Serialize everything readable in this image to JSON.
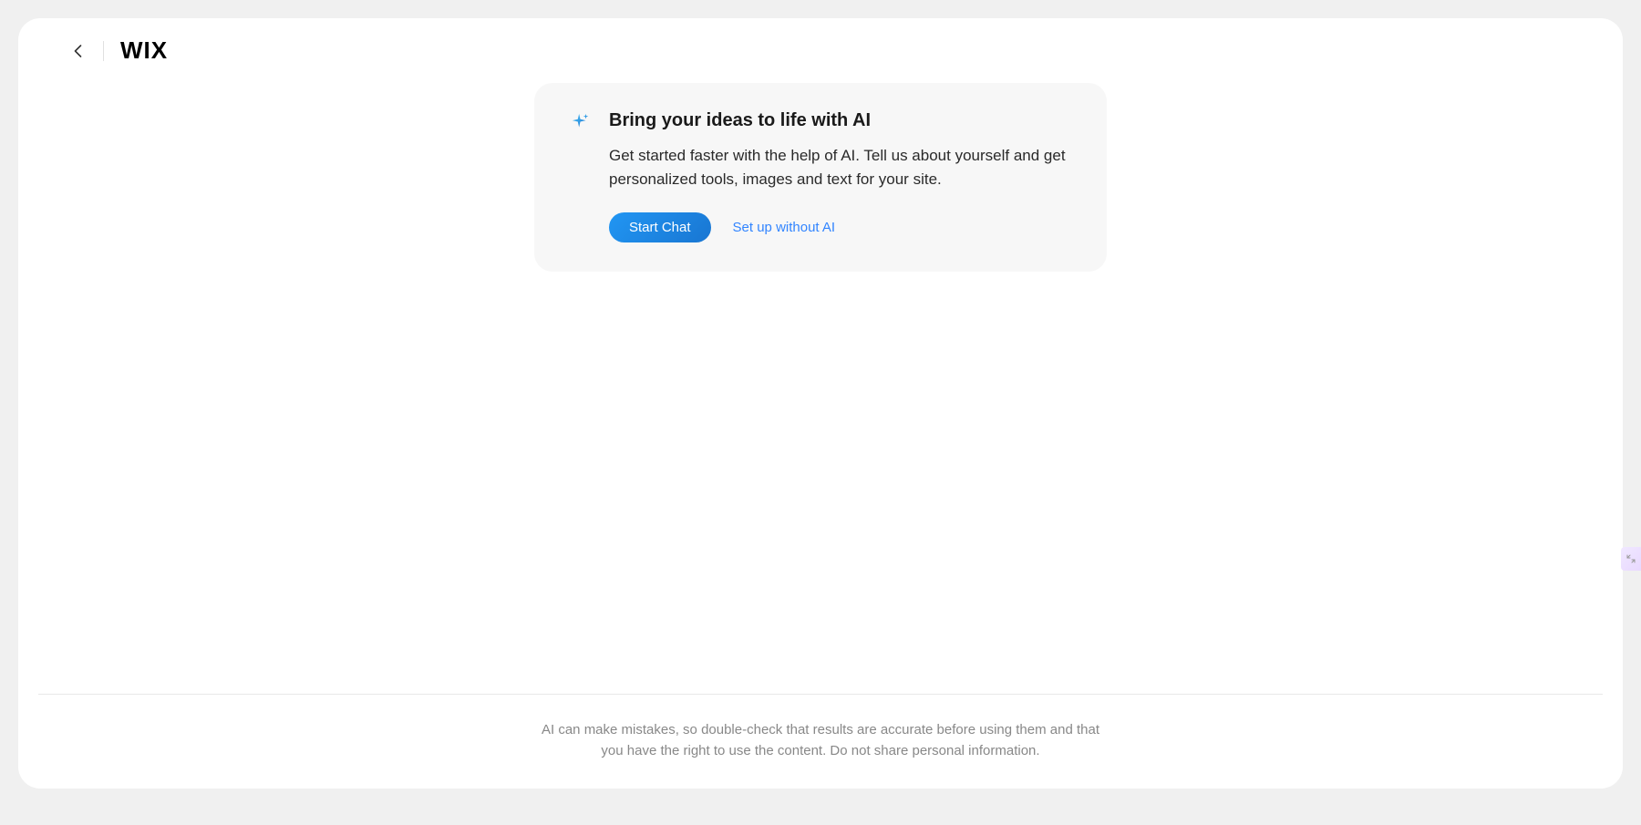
{
  "header": {
    "logo_text": "WIX"
  },
  "card": {
    "title": "Bring your ideas to life with AI",
    "description": "Get started faster with the help of AI. Tell us about yourself and get personalized tools, images and text for your site.",
    "primary_button_label": "Start Chat",
    "secondary_link_label": "Set up without AI"
  },
  "footer": {
    "disclaimer": "AI can make mistakes, so double-check that results are accurate before using them and that you have the right to use the content. Do not share personal information."
  }
}
